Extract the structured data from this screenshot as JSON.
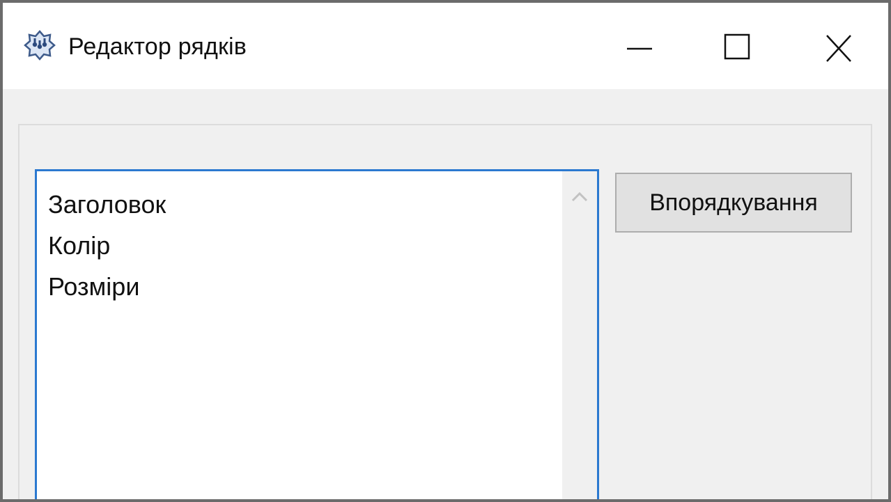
{
  "window": {
    "title": "Редактор рядків",
    "icon": "app-icon"
  },
  "titlebar_buttons": {
    "minimize": "minimize-icon",
    "maximize": "maximize-icon",
    "close": "close-icon"
  },
  "listbox": {
    "items": [
      "Заголовок",
      "Колір",
      "Розміри"
    ]
  },
  "sort_button": {
    "label": "Впорядкування"
  },
  "colors": {
    "listbox_border": "#2b79d0",
    "window_background": "#f0f0f0",
    "titlebar_background": "#ffffff",
    "button_background": "#e1e1e1"
  }
}
